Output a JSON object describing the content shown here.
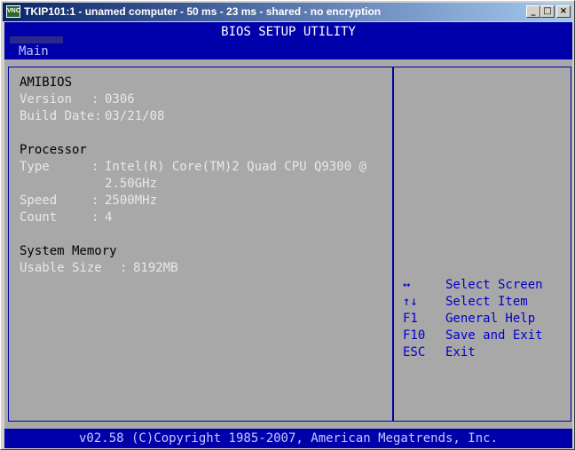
{
  "window": {
    "title": "TKIP101:1 - unamed computer - 50 ms - 23 ms - shared - no encryption",
    "icon_label": "VNC",
    "icon_name": "vnc-app-icon",
    "minimize": "_",
    "maximize": "□",
    "close": "×"
  },
  "bios": {
    "header": "BIOS SETUP UTILITY",
    "tab": "Main",
    "amibios": {
      "heading": "AMIBIOS",
      "version_label": "Version",
      "version_sep": ":",
      "version": "0306",
      "build_label": "Build Date:",
      "build_date": "03/21/08"
    },
    "processor": {
      "heading": "Processor",
      "type_label": "Type",
      "type_sep": ":",
      "type_line1": "Intel(R) Core(TM)2 Quad CPU Q9300 @",
      "type_line2": "2.50GHz",
      "speed_label": "Speed",
      "speed_sep": ":",
      "speed": "2500MHz",
      "count_label": "Count",
      "count_sep": ":",
      "count": "4"
    },
    "memory": {
      "heading": "System Memory",
      "usable_label": "Usable Size",
      "usable_sep": ":",
      "usable": "8192MB"
    },
    "help": [
      {
        "key": "↔",
        "action": "Select Screen"
      },
      {
        "key": "↑↓",
        "action": "Select Item"
      },
      {
        "key": "F1",
        "action": "General Help"
      },
      {
        "key": "F10",
        "action": "Save and Exit"
      },
      {
        "key": "ESC",
        "action": "Exit"
      }
    ],
    "footer": "v02.58 (C)Copyright 1985-2007, American Megatrends, Inc."
  },
  "colors": {
    "bios_blue": "#0000aa",
    "bios_gray": "#a8a8a8",
    "text_white": "#e8e8e8",
    "key_blue": "#0000cc"
  }
}
